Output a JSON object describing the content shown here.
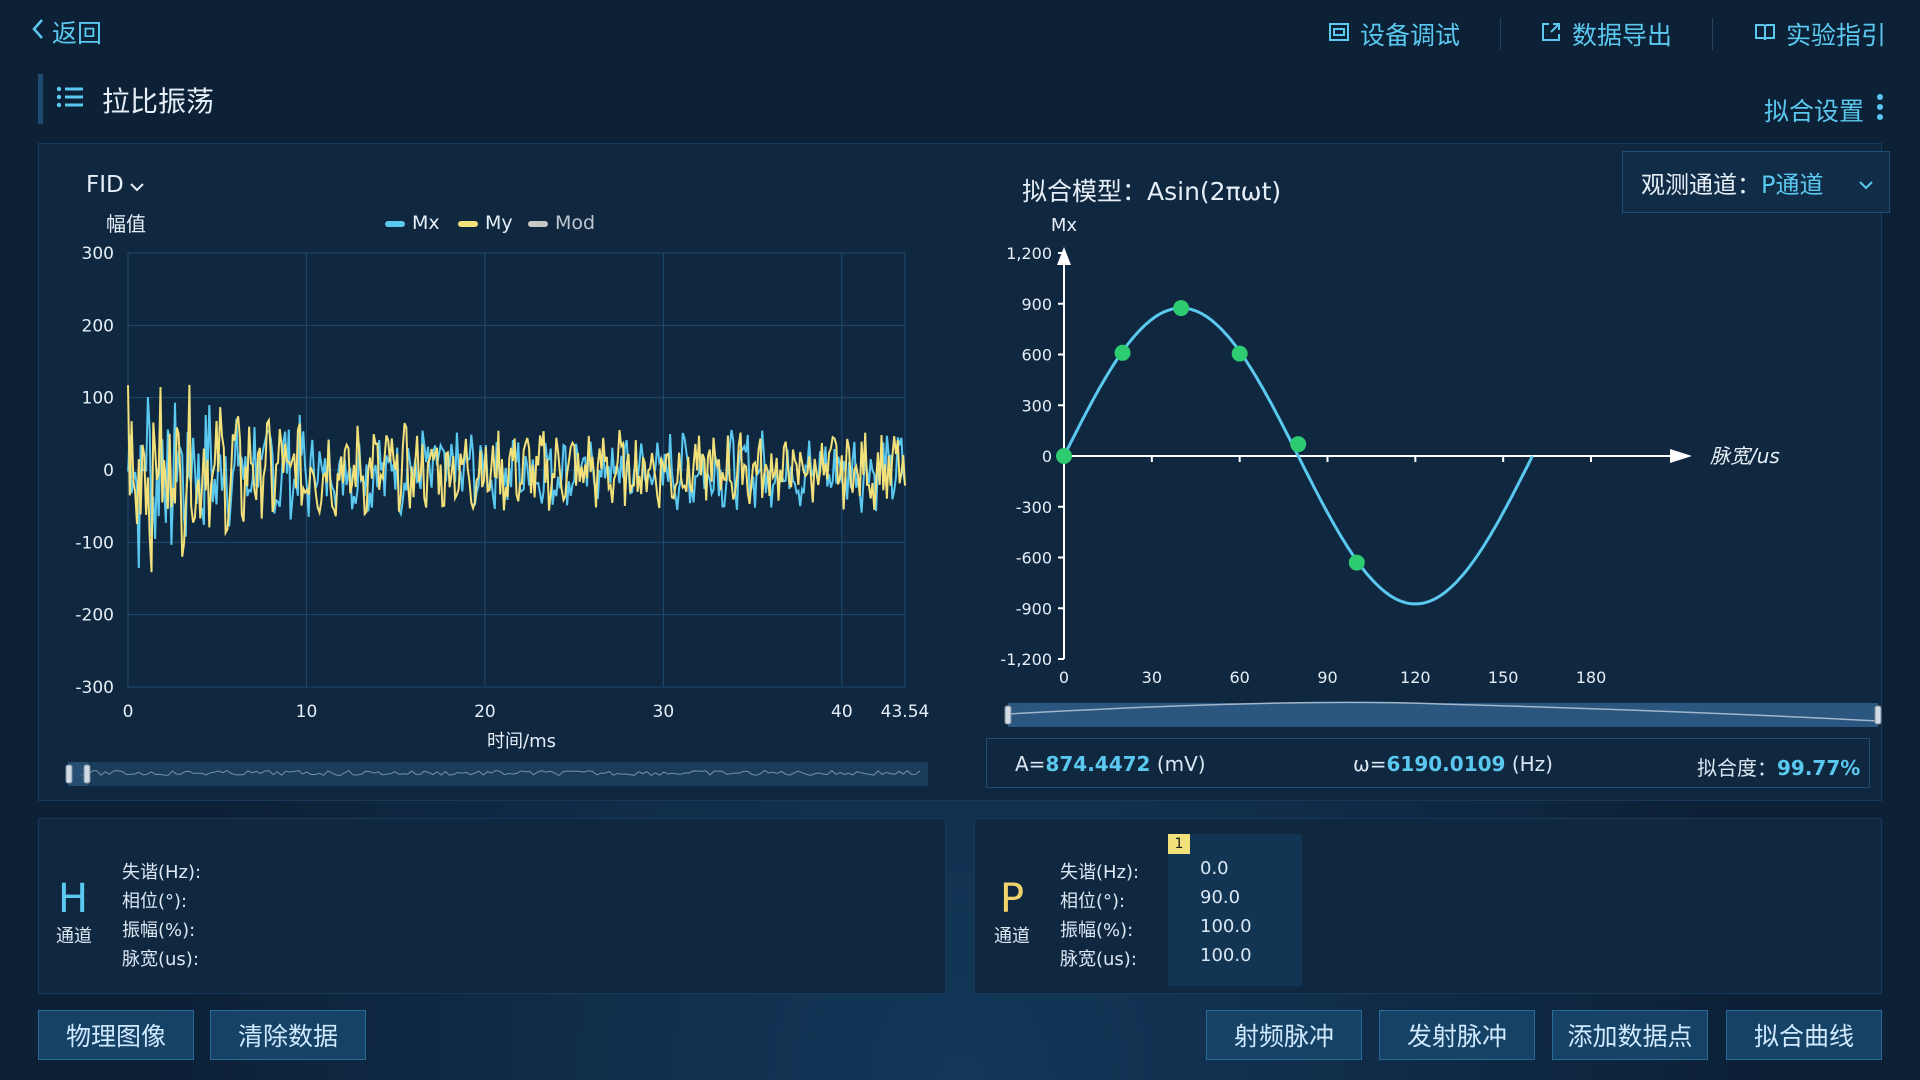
{
  "topbar": {
    "back_label": "返回",
    "nav": [
      {
        "label": "设备调试",
        "icon": "device-debug-icon"
      },
      {
        "label": "数据导出",
        "icon": "export-icon"
      },
      {
        "label": "实验指引",
        "icon": "book-icon"
      }
    ]
  },
  "page_title": "拉比振荡",
  "fit_settings_label": "拟合设置",
  "left_panel": {
    "dropdown": "FID"
  },
  "right_panel": {
    "fit_model_label": "拟合模型：",
    "fit_model_formula": "Asin(2πωt)",
    "channel_label": "观测通道：",
    "channel_value": "P通道"
  },
  "result": {
    "a_prefix": "A=",
    "a_value": "874.4472",
    "a_unit": "(mV)",
    "w_prefix": "ω=",
    "w_value": "6190.0109",
    "w_unit": "(Hz)",
    "fit_label": "拟合度：",
    "fit_value": "99.77%"
  },
  "channel_h": {
    "letter": "H",
    "sub": "通道",
    "params": [
      "失谐(Hz):",
      "相位(°):",
      "振幅(%):",
      "脉宽(us):"
    ]
  },
  "channel_p": {
    "letter": "P",
    "sub": "通道",
    "params": [
      "失谐(Hz):",
      "相位(°):",
      "振幅(%):",
      "脉宽(us):"
    ],
    "tab_index": "1",
    "values": [
      "0.0",
      "90.0",
      "100.0",
      "100.0"
    ]
  },
  "buttons": {
    "physical_image": "物理图像",
    "clear_data": "清除数据",
    "rf_pulse": "射频脉冲",
    "emit_pulse": "发射脉冲",
    "add_point": "添加数据点",
    "fit_curve": "拟合曲线"
  },
  "colors": {
    "accent": "#5bc8f0",
    "mx": "#5bc8f0",
    "my": "#f2e07a",
    "mod": "#c8c8c8",
    "point": "#2ecc71",
    "h_channel": "#5bc8f0",
    "p_channel": "#f2d36b"
  },
  "chart_data": [
    {
      "type": "line",
      "title": "",
      "ylabel": "幅值",
      "xlabel": "时间/ms",
      "xlim": [
        0,
        43.54
      ],
      "ylim": [
        -300,
        300
      ],
      "x_ticks": [
        "0",
        "10",
        "20",
        "30",
        "40",
        "43.54"
      ],
      "y_ticks": [
        "300",
        "200",
        "100",
        "0",
        "-100",
        "-200",
        "-300"
      ],
      "grid": true,
      "legend": "top",
      "series": [
        {
          "name": "Mx",
          "description": "noisy decaying oscillation around 0",
          "values": []
        },
        {
          "name": "My",
          "description": "noisy decaying oscillation around 0",
          "values": []
        },
        {
          "name": "Mod",
          "values": []
        }
      ]
    },
    {
      "type": "scatter",
      "title": "",
      "ylabel": "Mx",
      "xlabel": "脉宽/us",
      "xlim": [
        0,
        180
      ],
      "ylim": [
        -1200,
        1200
      ],
      "x_ticks": [
        "0",
        "30",
        "60",
        "90",
        "120",
        "150",
        "180"
      ],
      "y_ticks": [
        "1,200",
        "900",
        "600",
        "300",
        "0",
        "-300",
        "-600",
        "-900",
        "-1,200"
      ],
      "grid": false,
      "points": {
        "x": [
          0,
          20,
          40,
          60,
          80,
          100
        ],
        "y": [
          0,
          610,
          874,
          605,
          70,
          -630
        ]
      },
      "fit_curve": {
        "model": "Asin(2πωt)",
        "A": 874.4472,
        "x_range": [
          0,
          160
        ],
        "half_period_us": 80
      }
    }
  ]
}
